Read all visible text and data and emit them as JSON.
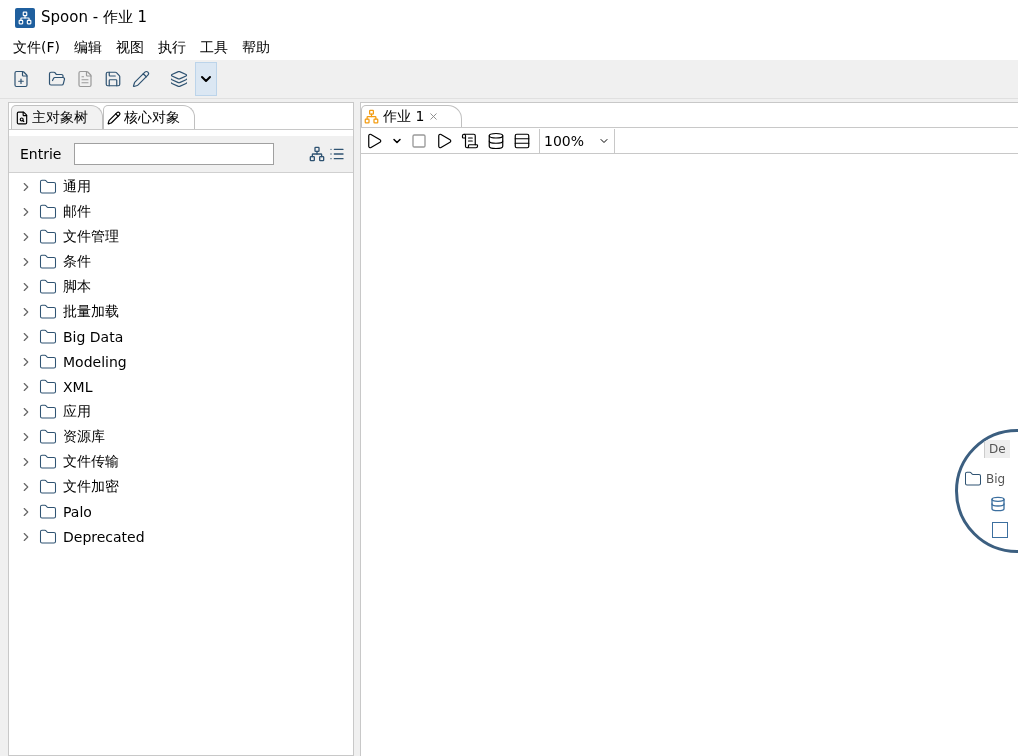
{
  "window": {
    "title": "Spoon - 作业 1"
  },
  "menu": [
    "文件(F)",
    "编辑",
    "视图",
    "执行",
    "工具",
    "帮助"
  ],
  "left_panel": {
    "tabs": [
      {
        "label": "主对象树",
        "selected": false
      },
      {
        "label": "核心对象",
        "selected": true
      }
    ],
    "search": {
      "label": "Entrie"
    },
    "tree": [
      {
        "label": "通用",
        "expanded": false
      },
      {
        "label": "邮件",
        "expanded": false
      },
      {
        "label": "文件管理",
        "expanded": false
      },
      {
        "label": "条件",
        "expanded": false
      },
      {
        "label": "脚本",
        "expanded": false
      },
      {
        "label": "批量加载",
        "expanded": false
      },
      {
        "label": "Big Data",
        "expanded": false
      },
      {
        "label": "Modeling",
        "expanded": false
      },
      {
        "label": "XML",
        "expanded": false
      },
      {
        "label": "应用",
        "expanded": false
      },
      {
        "label": "资源库",
        "expanded": false
      },
      {
        "label": "文件传输",
        "expanded": false
      },
      {
        "label": "文件加密",
        "expanded": false
      },
      {
        "label": "Palo",
        "expanded": false
      },
      {
        "label": "Deprecated",
        "expanded": false
      }
    ]
  },
  "editor": {
    "tabs": [
      {
        "label": "作业 1",
        "selected": true
      }
    ],
    "zoom": "100%"
  },
  "magnifier": {
    "tab": "De",
    "folder": "Big"
  }
}
